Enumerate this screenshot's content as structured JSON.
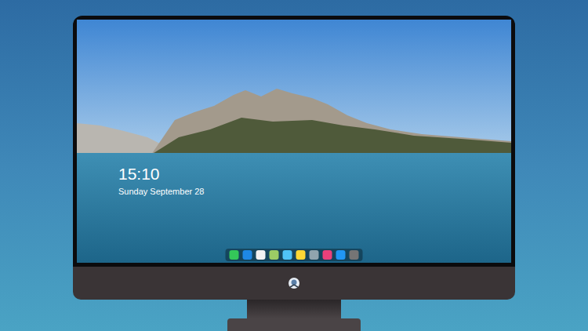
{
  "lock_screen": {
    "time": "15:10",
    "date": "Sunday September 28"
  },
  "dock": {
    "apps": [
      {
        "color": "#34c759"
      },
      {
        "color": "#1e88e5"
      },
      {
        "color": "#f2f2f2"
      },
      {
        "color": "#9ccc65"
      },
      {
        "color": "#4fc3f7"
      },
      {
        "color": "#fdd835"
      },
      {
        "color": "#90a4ae"
      },
      {
        "color": "#ec407a"
      },
      {
        "color": "#2196f3"
      },
      {
        "color": "#757575"
      }
    ]
  }
}
